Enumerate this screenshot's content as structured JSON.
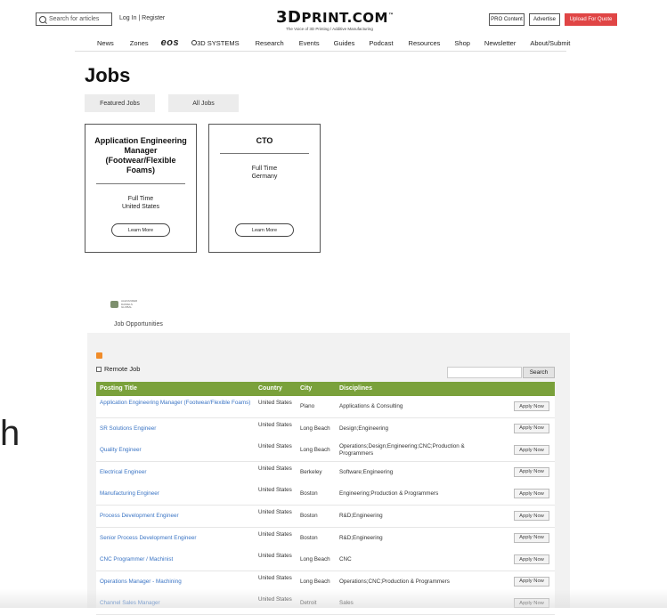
{
  "header": {
    "search_placeholder": "Search for articles",
    "login_label": "Log In | Register",
    "logo_main_big": "3D",
    "logo_main_rest": "PRINT.COM",
    "logo_tm": "™",
    "logo_tagline": "The Voice of 3D Printing / Additive Manufacturing",
    "pro_content_label": "PRO Content",
    "advertise_label": "Advertise",
    "upload_label": "Upload For Quote",
    "upload_color": "#e04545"
  },
  "nav": {
    "items": [
      "News",
      "Zones",
      "eos",
      "3D SYSTEMS",
      "Research",
      "Events",
      "Guides",
      "Podcast",
      "Resources",
      "Shop",
      "Newsletter",
      "About/Submit"
    ]
  },
  "jobs": {
    "title": "Jobs",
    "tabs": [
      "Featured Jobs",
      "All Jobs"
    ],
    "cards": [
      {
        "title": "Application Engineering Manager (Footwear/Flexible Foams)",
        "type": "Full Time",
        "location": "United States",
        "button": "Learn More"
      },
      {
        "title": "CTO",
        "type": "Full Time",
        "location": "Germany",
        "button": "Learn More"
      }
    ]
  },
  "company": {
    "logo_text": "ALEXANDER DANIELS GLOBAL",
    "section_label": "Job Opportunities"
  },
  "board": {
    "remote_label": "Remote Job",
    "search_button": "Search",
    "accent_color": "#7aa13b",
    "columns": [
      "Posting Title",
      "Country",
      "City",
      "Disciplines"
    ],
    "apply_label": "Apply Now",
    "rows": [
      {
        "title": "Application Engineering Manager (Footwear/Flexible Foams)",
        "country": "United States",
        "city": "Plano",
        "disciplines": "Applications & Consulting"
      },
      {
        "title": "SR Solutions Engineer",
        "country": "United States",
        "city": "Long Beach",
        "disciplines": "Design;Engineering"
      },
      {
        "title": "Quality Engineer",
        "country": "United States",
        "city": "Long Beach",
        "disciplines": "Operations;Design;Engineering;CNC;Production & Programmers"
      },
      {
        "title": "Electrical Engineer",
        "country": "United States",
        "city": "Berkeley",
        "disciplines": "Software;Engineering"
      },
      {
        "title": "Manufacturing Engineer",
        "country": "United States",
        "city": "Boston",
        "disciplines": "Engineering;Production & Programmers"
      },
      {
        "title": "Process Development Engineer",
        "country": "United States",
        "city": "Boston",
        "disciplines": "R&D;Engineering"
      },
      {
        "title": "Senior Process Development Engineer",
        "country": "United States",
        "city": "Boston",
        "disciplines": "R&D;Engineering"
      },
      {
        "title": "CNC Programmer / Machinist",
        "country": "United States",
        "city": "Long Beach",
        "disciplines": "CNC"
      },
      {
        "title": "Operations Manager - Machining",
        "country": "United States",
        "city": "Long Beach",
        "disciplines": "Operations;CNC;Production & Programmers"
      },
      {
        "title": "Channel Sales Manager",
        "country": "United States",
        "city": "Detroit",
        "disciplines": "Sales"
      }
    ]
  },
  "edge_fragment": "h"
}
